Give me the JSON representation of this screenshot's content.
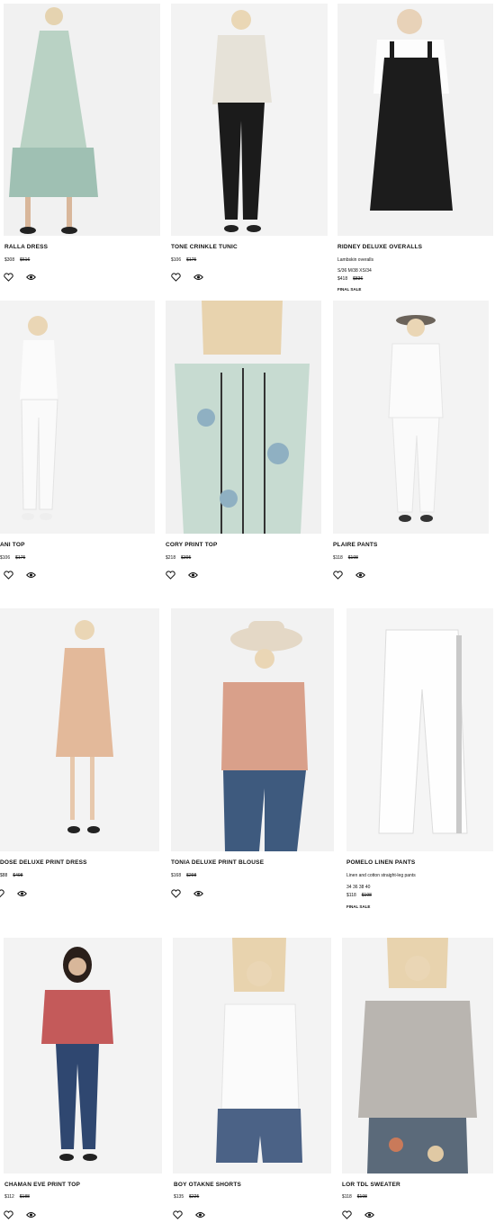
{
  "colors": {
    "text": "#111111",
    "image_bg": "#f2f2f2",
    "wall": "#f4f4f4"
  },
  "icons": {
    "wishlist": "heart-icon",
    "quick_view": "eye-icon"
  },
  "products": [
    {
      "name": "RALLA DRESS",
      "price": "$308",
      "old_price": "$616"
    },
    {
      "name": "TONE CRINKLE TUNIC",
      "price": "$106",
      "old_price": "$175"
    },
    {
      "name": "RIDNEY DELUXE OVERALLS",
      "desc": "Lambskin overalls",
      "sizes": "S/36 M/38 XS/34",
      "price": "$418",
      "old_price": "$836",
      "final": "FINAL SALE"
    },
    {
      "name": "ANI TOP",
      "price": "$106",
      "old_price": "$175"
    },
    {
      "name": "CORY PRINT TOP",
      "price": "$218",
      "old_price": "$395"
    },
    {
      "name": "PLAIRE PANTS",
      "price": "$118",
      "old_price": "$198"
    },
    {
      "name": "DOSE DELUXE PRINT DRESS",
      "price": "$88",
      "old_price": "$498"
    },
    {
      "name": "TONIA DELUXE PRINT BLOUSE",
      "price": "$168",
      "old_price": "$298"
    },
    {
      "name": "POMELO LINEN PANTS",
      "desc": "Linen and cotton straight-leg pants",
      "sizes": "34 36 38 40",
      "price": "$118",
      "old_price": "$198",
      "final": "FINAL SALE"
    },
    {
      "name": "CHAMAN EVE PRINT TOP",
      "price": "$112",
      "old_price": "$188"
    },
    {
      "name": "BOY OTAKNE SHORTS",
      "price": "$135",
      "old_price": "$225"
    },
    {
      "name": "LOR TDL SWEATER",
      "price": "$118",
      "old_price": "$198"
    }
  ]
}
